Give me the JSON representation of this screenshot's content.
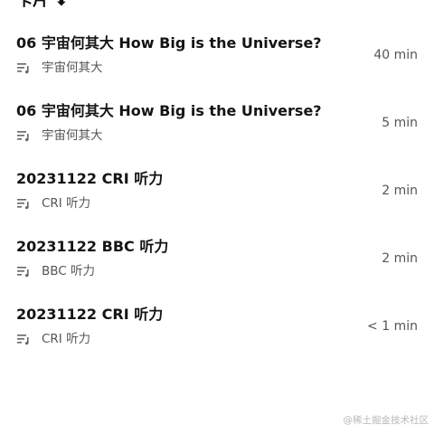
{
  "top_partial": {
    "text": "卡片 ⬇"
  },
  "items": [
    {
      "title": "06 宇宙何其大 How Big is the Universe?",
      "subtitle": "宇宙何其大",
      "duration": "40 min"
    },
    {
      "title": "06 宇宙何其大 How Big is the Universe?",
      "subtitle": "宇宙何其大",
      "duration": "5 min"
    },
    {
      "title": "20231122 CRI 听力",
      "subtitle": "CRI 听力",
      "duration": "2 min"
    },
    {
      "title": "20231122 BBC 听力",
      "subtitle": "BBC 听力",
      "duration": "2 min"
    },
    {
      "title": "20231122 CRI 听力",
      "subtitle": "CRI 听力",
      "duration": "< 1 min"
    }
  ],
  "icons": {
    "subtitle_icon": "playlist-icon"
  },
  "watermark": "@稀土掘金技术社区"
}
